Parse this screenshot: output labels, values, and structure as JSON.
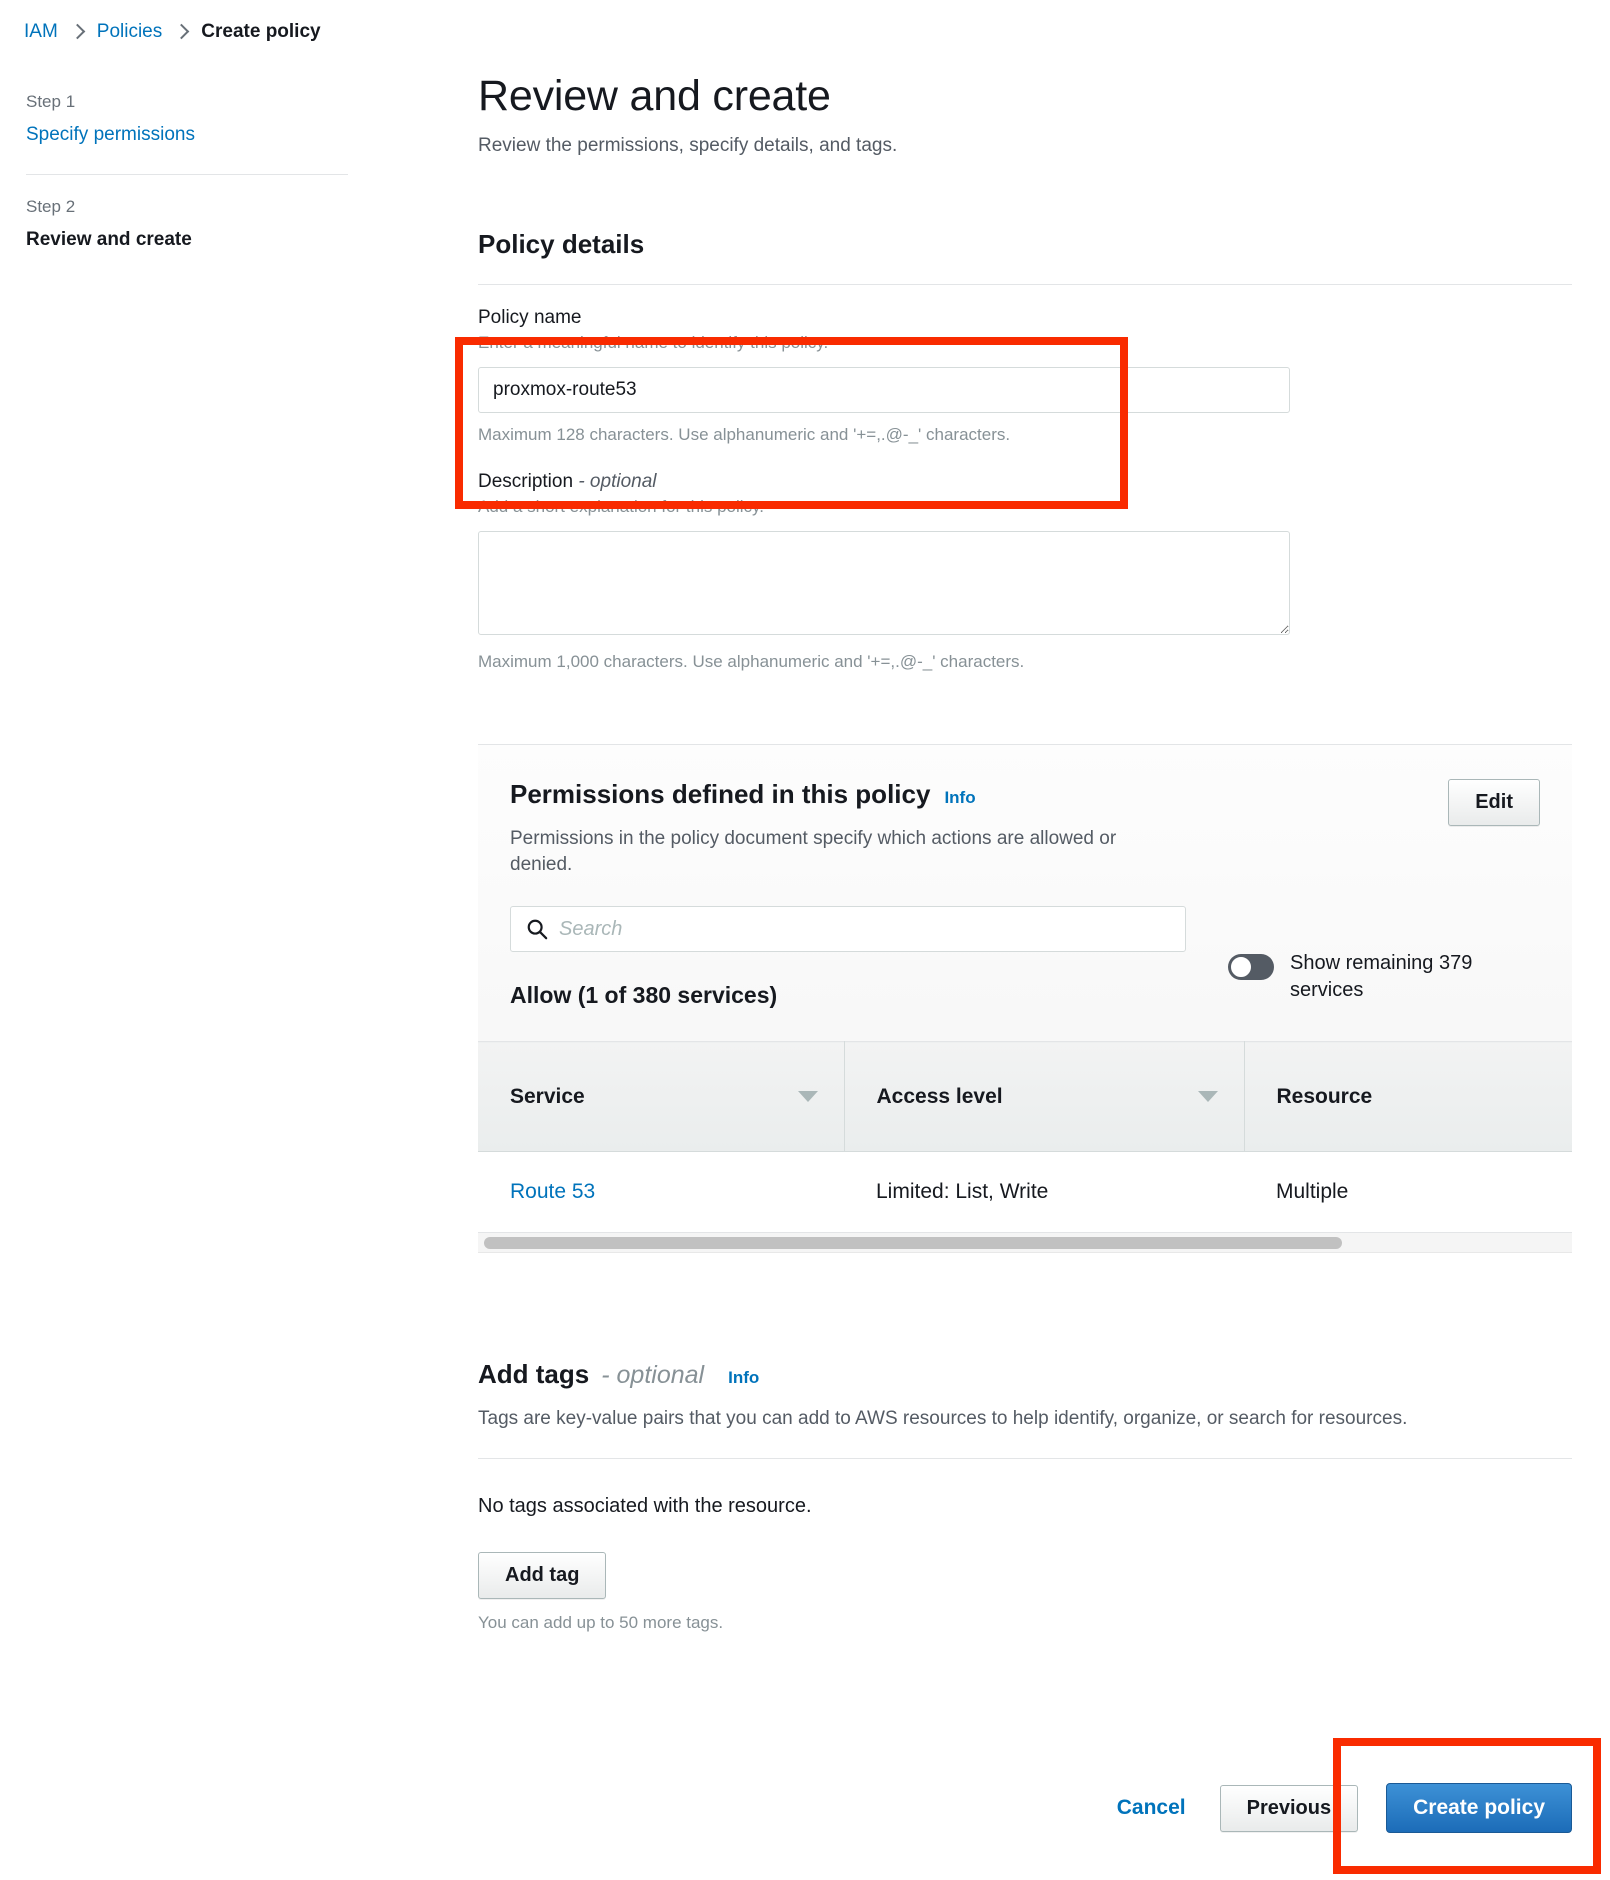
{
  "breadcrumb": {
    "items": [
      {
        "label": "IAM",
        "current": false
      },
      {
        "label": "Policies",
        "current": false
      },
      {
        "label": "Create policy",
        "current": true
      }
    ]
  },
  "stepnav": {
    "steps": [
      {
        "step_label": "Step 1",
        "title": "Specify permissions",
        "current": false
      },
      {
        "step_label": "Step 2",
        "title": "Review and create",
        "current": true
      }
    ]
  },
  "page": {
    "title": "Review and create",
    "subtitle": "Review the permissions, specify details, and tags."
  },
  "policy_details": {
    "section_title": "Policy details",
    "policy_name": {
      "label": "Policy name",
      "description": "Enter a meaningful name to identify this policy.",
      "value": "proxmox-route53",
      "placeholder": "",
      "hint": "Maximum 128 characters. Use alphanumeric and '+=,.@-_' characters."
    },
    "description": {
      "label": "Description",
      "optional_suffix": "- optional",
      "description": "Add a short explanation for this policy.",
      "value": "",
      "placeholder": "",
      "hint": "Maximum 1,000 characters. Use alphanumeric and '+=,.@-_' characters."
    }
  },
  "permissions": {
    "title": "Permissions defined in this policy",
    "info_label": "Info",
    "description": "Permissions in the policy document specify which actions are allowed or denied.",
    "edit_label": "Edit",
    "search_placeholder": "Search",
    "search_value": "",
    "toggle": {
      "label": "Show remaining 379 services",
      "state": "off"
    },
    "allow_heading": "Allow (1 of 380 services)",
    "table": {
      "columns": [
        "Service",
        "Access level",
        "Resource"
      ],
      "rows": [
        {
          "service": "Route 53",
          "access_level": "Limited: List, Write",
          "resource": "Multiple"
        }
      ]
    }
  },
  "tags": {
    "title": "Add tags",
    "optional_suffix": "- optional",
    "info_label": "Info",
    "description": "Tags are key-value pairs that you can add to AWS resources to help identify, organize, or search for resources.",
    "empty_note": "No tags associated with the resource.",
    "add_tag_label": "Add tag",
    "hint": "You can add up to 50 more tags."
  },
  "footer": {
    "cancel_label": "Cancel",
    "previous_label": "Previous",
    "create_label": "Create policy"
  },
  "annotations": {
    "highlight_color": "#f92b00",
    "boxes": [
      "policy-name-field",
      "create-policy-button"
    ]
  },
  "colors": {
    "link": "#0073bb",
    "primary_button": "#1c6cb8",
    "text": "#16191f",
    "muted": "#879196",
    "highlight": "#f92b00"
  }
}
